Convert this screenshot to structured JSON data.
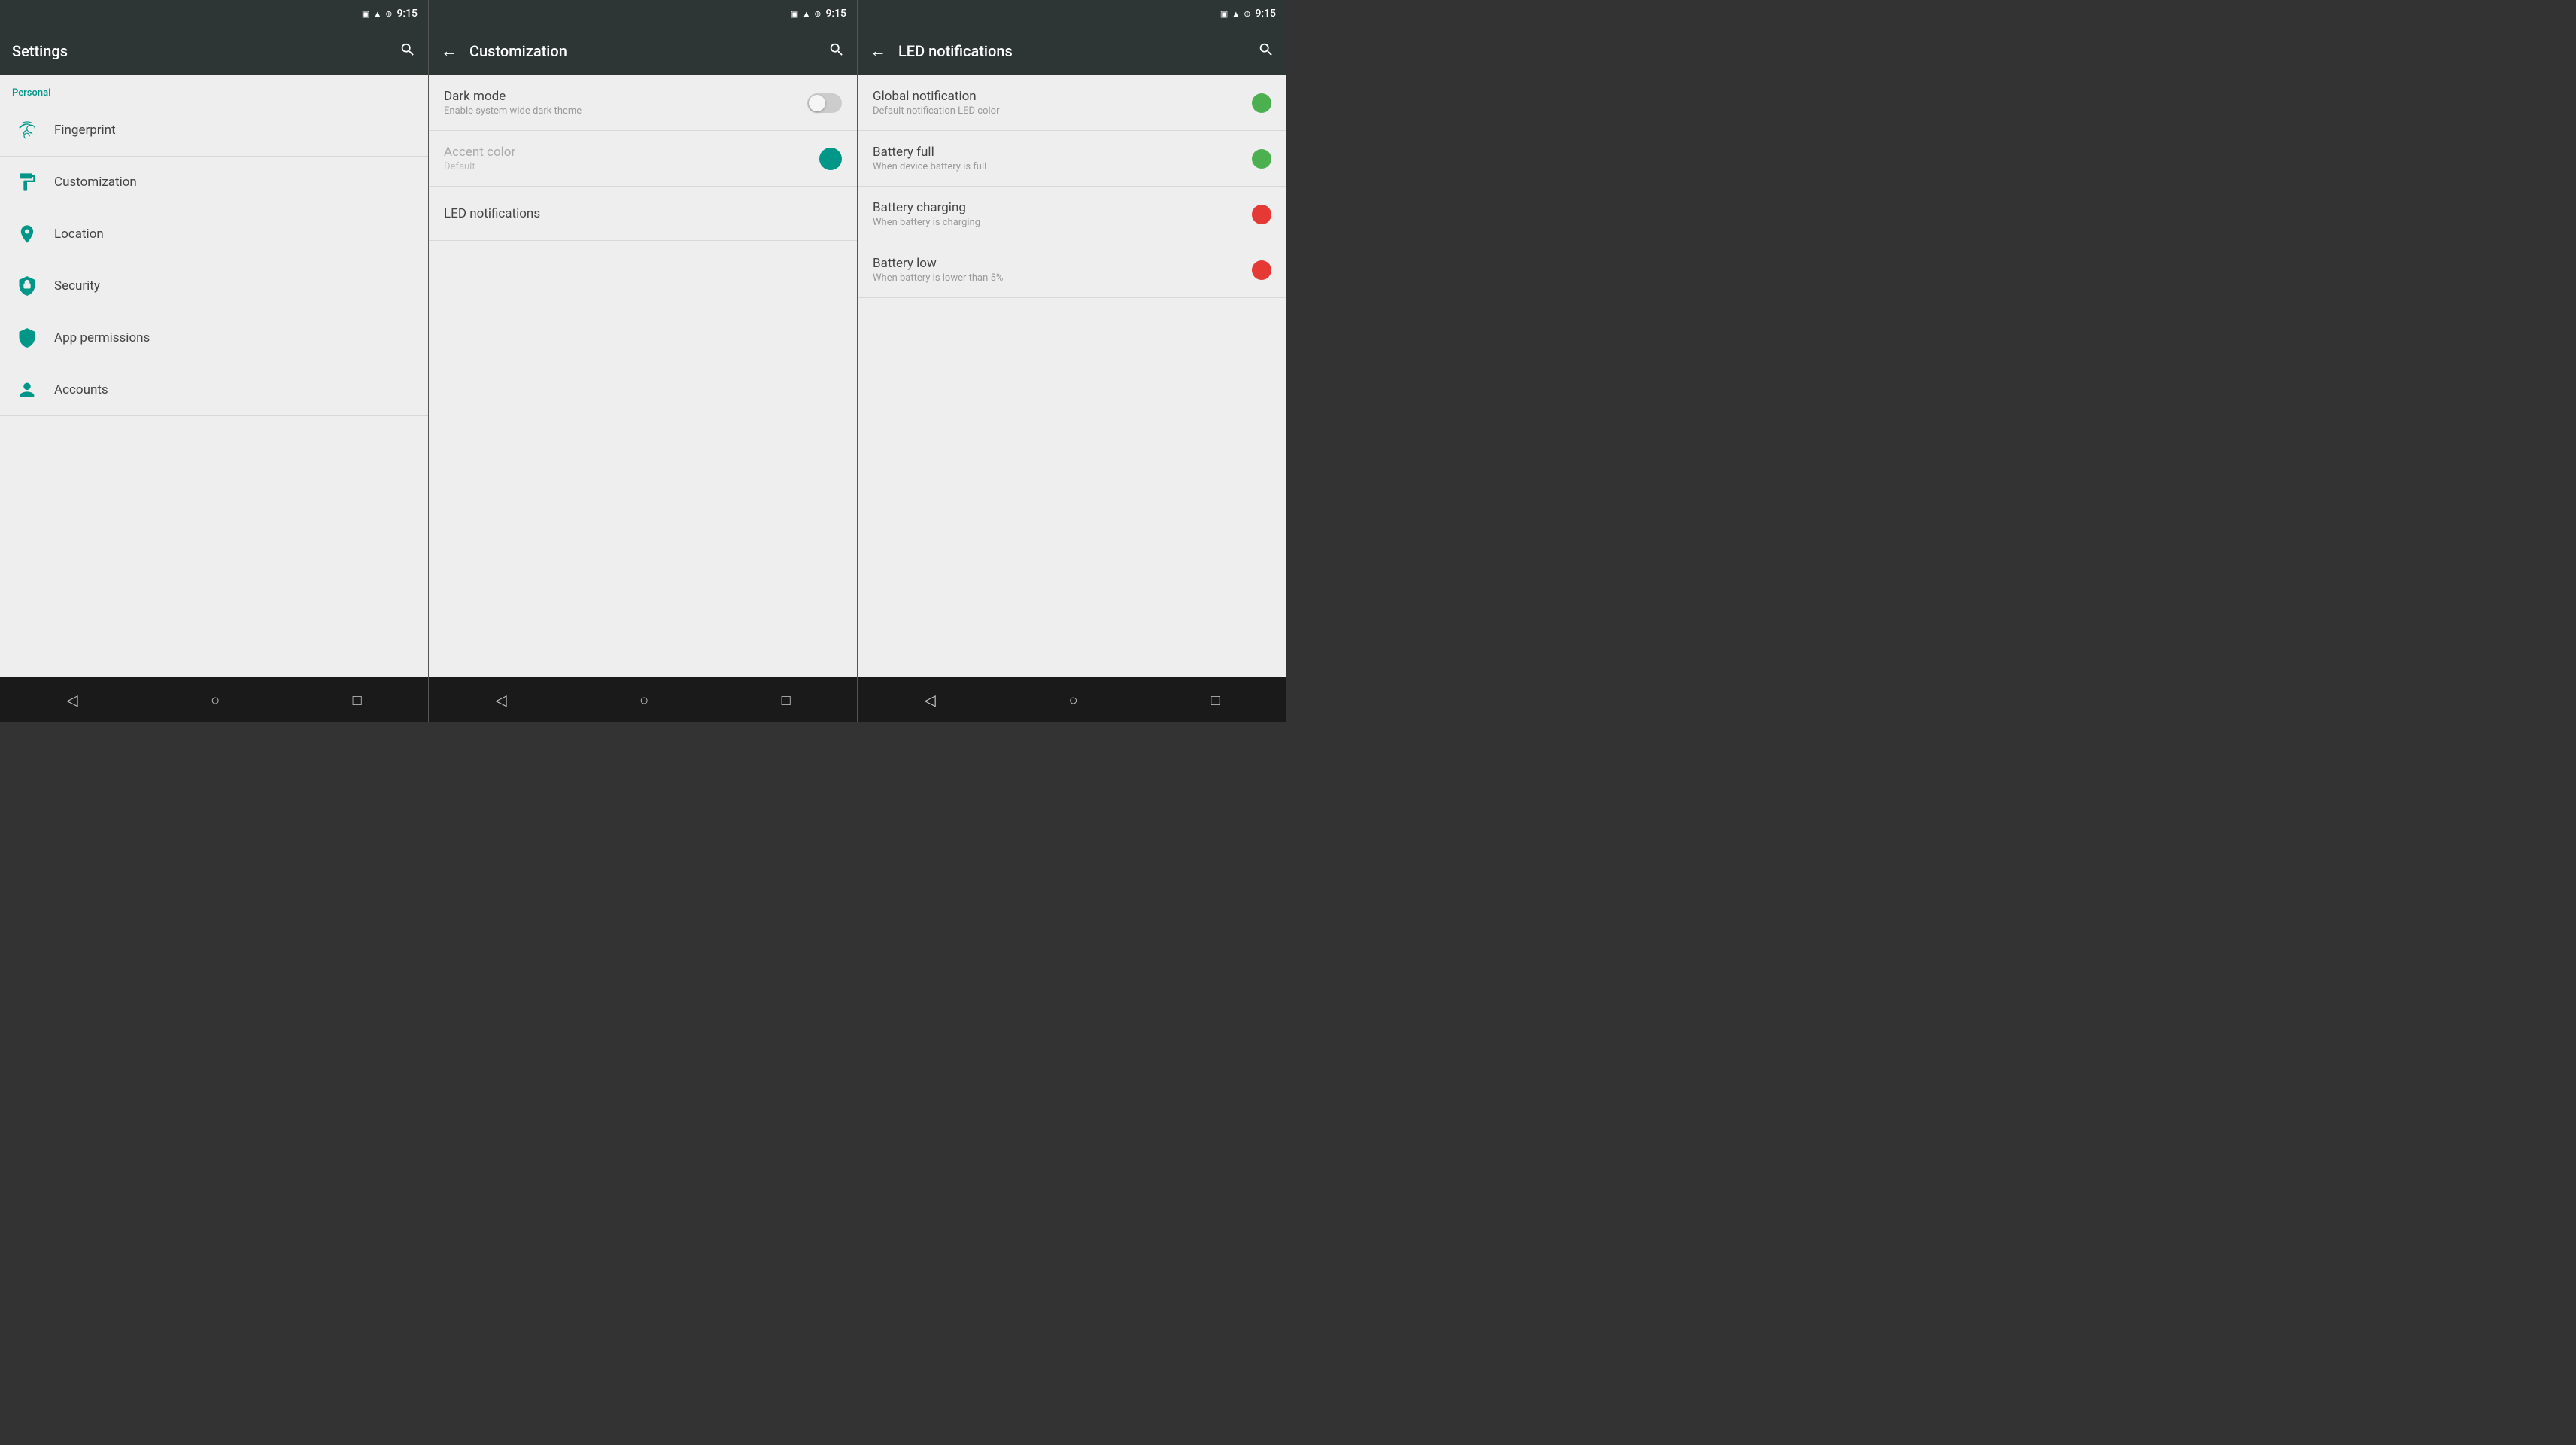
{
  "panels": {
    "settings": {
      "title": "Settings",
      "time": "9:15",
      "section_personal": "Personal",
      "items": [
        {
          "id": "fingerprint",
          "label": "Fingerprint"
        },
        {
          "id": "customization",
          "label": "Customization"
        },
        {
          "id": "location",
          "label": "Location"
        },
        {
          "id": "security",
          "label": "Security"
        },
        {
          "id": "app-permissions",
          "label": "App permissions"
        },
        {
          "id": "accounts",
          "label": "Accounts"
        }
      ],
      "nav": {
        "back": "◁",
        "home": "○",
        "recents": "□"
      }
    },
    "customization": {
      "title": "Customization",
      "time": "9:15",
      "items": [
        {
          "id": "dark-mode",
          "title": "Dark mode",
          "subtitle": "Enable system wide dark theme",
          "type": "toggle",
          "toggled": false,
          "disabled": false
        },
        {
          "id": "accent-color",
          "title": "Accent color",
          "subtitle": "Default",
          "type": "color",
          "color": "#009688",
          "disabled": true
        },
        {
          "id": "led-notifications",
          "title": "LED notifications",
          "subtitle": "",
          "type": "navigate",
          "disabled": false
        }
      ],
      "nav": {
        "back": "◁",
        "home": "○",
        "recents": "□"
      }
    },
    "led": {
      "title": "LED notifications",
      "time": "9:15",
      "items": [
        {
          "id": "global-notification",
          "title": "Global notification",
          "subtitle": "Default notification LED color",
          "color": "#4caf50"
        },
        {
          "id": "battery-full",
          "title": "Battery full",
          "subtitle": "When device battery is full",
          "color": "#4caf50"
        },
        {
          "id": "battery-charging",
          "title": "Battery charging",
          "subtitle": "When battery is charging",
          "color": "#e53935"
        },
        {
          "id": "battery-low",
          "title": "Battery low",
          "subtitle": "When battery is lower than 5%",
          "color": "#e53935"
        }
      ],
      "nav": {
        "back": "◁",
        "home": "○",
        "recents": "□"
      }
    }
  },
  "icons": {
    "fingerprint": "fingerprint-icon",
    "customization": "format-paint-icon",
    "location": "location-icon",
    "security": "security-icon",
    "app-permissions": "shield-icon",
    "accounts": "account-icon",
    "search": "search-icon",
    "back": "back-icon"
  },
  "colors": {
    "teal": "#009688",
    "header_bg": "#2d3535",
    "background": "#eeeeee",
    "nav_bg": "#1a1a1a",
    "green_led": "#4caf50",
    "red_led": "#e53935"
  }
}
